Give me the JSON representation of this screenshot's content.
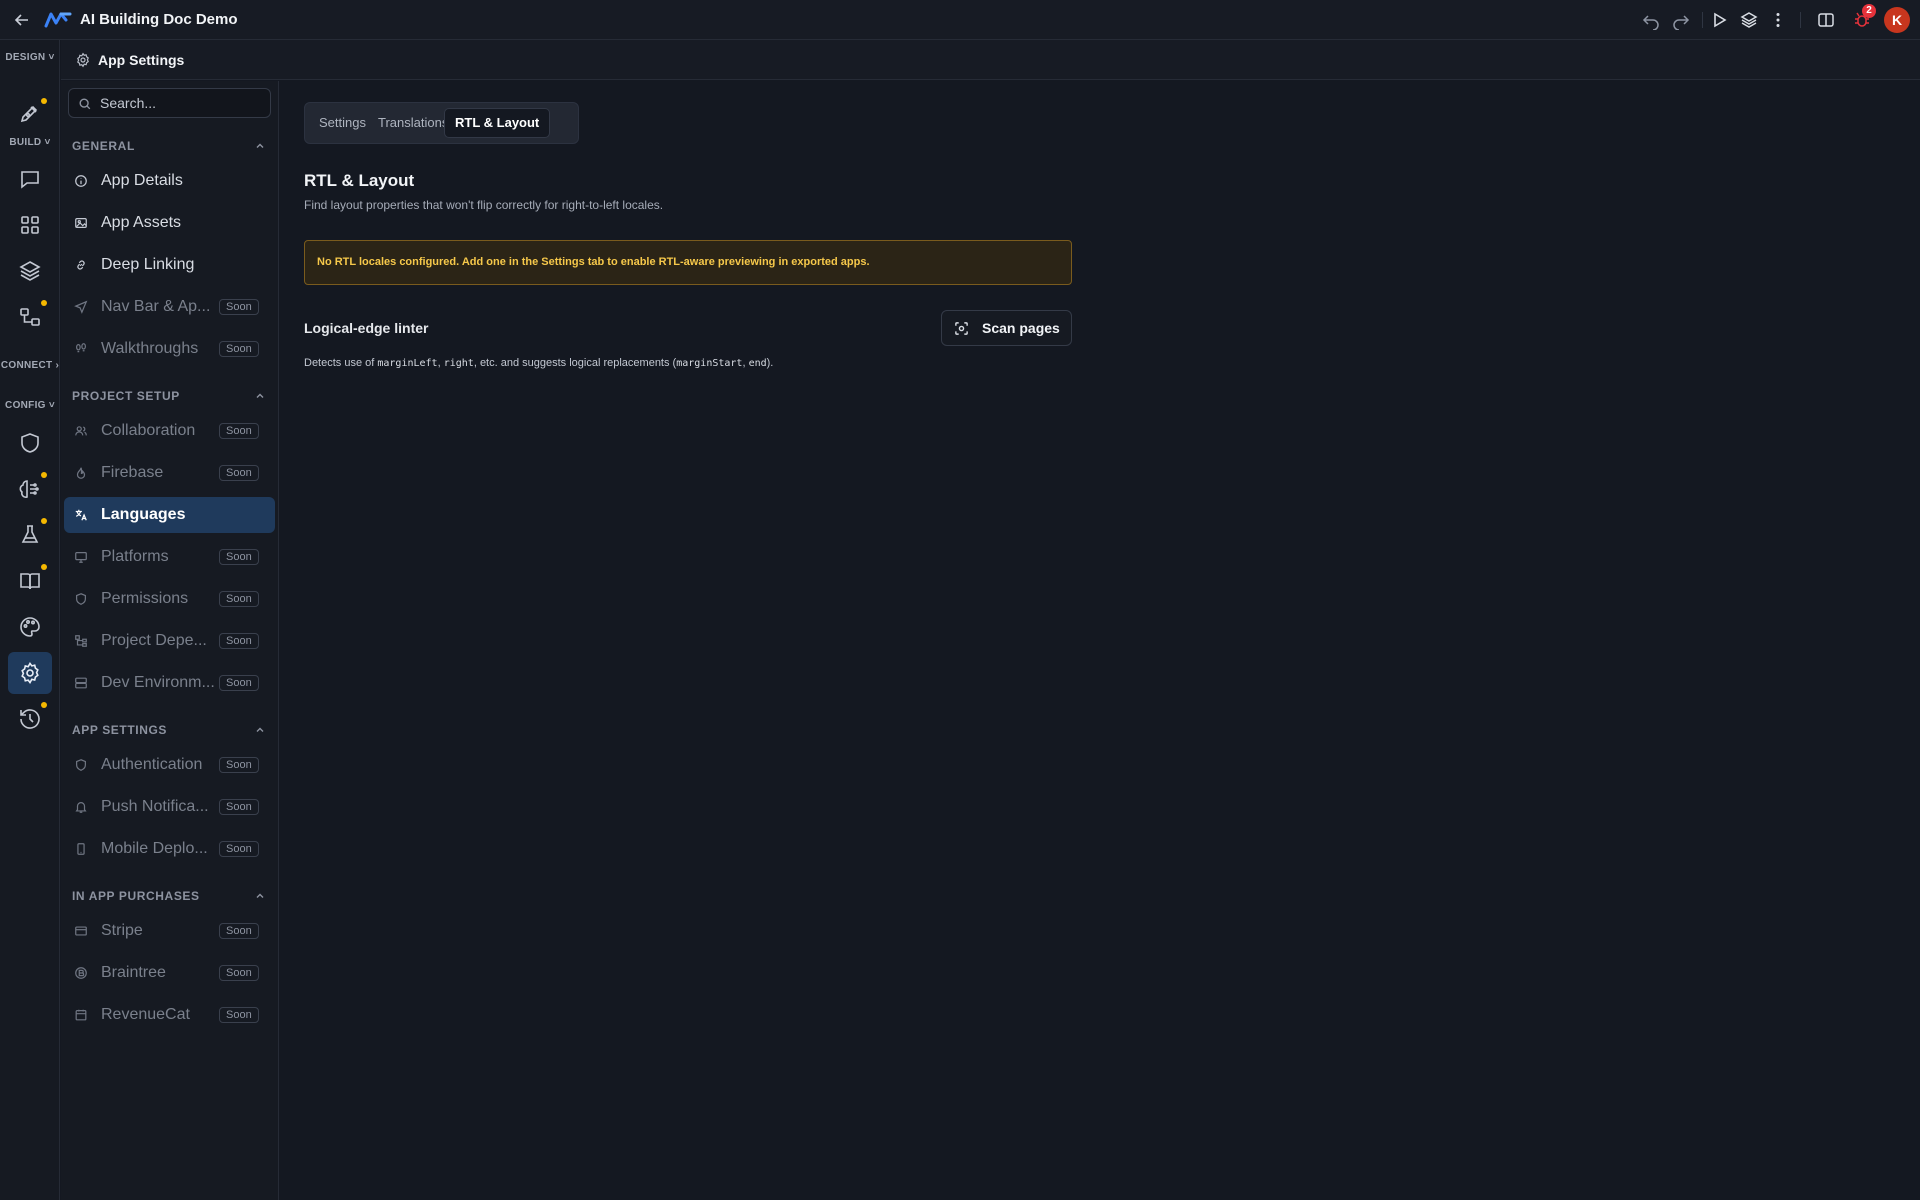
{
  "topbar": {
    "title": "AI Building Doc Demo",
    "notification_count": "2",
    "avatar_initial": "K"
  },
  "rail": {
    "sections": {
      "design": "DESIGN",
      "build": "BUILD",
      "connect": "CONNECT",
      "config": "CONFIG"
    }
  },
  "settings_header": {
    "title": "App Settings"
  },
  "sidebar": {
    "search_placeholder": "Search...",
    "soon_label": "Soon",
    "groups": {
      "general": {
        "title": "GENERAL",
        "items": [
          "App Details",
          "App Assets",
          "Deep Linking",
          "Nav Bar & Ap...",
          "Walkthroughs"
        ]
      },
      "project_setup": {
        "title": "PROJECT SETUP",
        "items": [
          "Collaboration",
          "Firebase",
          "Languages",
          "Platforms",
          "Permissions",
          "Project Depe...",
          "Dev Environm..."
        ]
      },
      "app_settings": {
        "title": "APP SETTINGS",
        "items": [
          "Authentication",
          "Push Notifica...",
          "Mobile Deplo..."
        ]
      },
      "in_app_purchases": {
        "title": "IN APP PURCHASES",
        "items": [
          "Stripe",
          "Braintree",
          "RevenueCat"
        ]
      }
    }
  },
  "main": {
    "tabs": [
      "Settings",
      "Translations",
      "RTL & Layout"
    ],
    "title": "RTL & Layout",
    "subtitle": "Find layout properties that won't flip correctly for right-to-left locales.",
    "alert": "No RTL locales configured. Add one in the Settings tab to enable RTL-aware previewing in exported apps.",
    "linter": {
      "title": "Logical-edge linter",
      "button": "Scan pages",
      "desc_1": "Detects use of ",
      "code_1": "marginLeft",
      "desc_2": ", ",
      "code_2": "right",
      "desc_3": ", etc. and suggests logical replacements (",
      "code_3": "marginStart",
      "desc_4": ", ",
      "code_4": "end",
      "desc_5": ")."
    }
  },
  "colors": {
    "accent_active": "#1f3a5c",
    "warning_text": "#f6c84a",
    "warning_border": "#7a5b1d",
    "notification_dot": "#f5b800",
    "badge": "#e5323b",
    "avatar": "#c8361e"
  }
}
